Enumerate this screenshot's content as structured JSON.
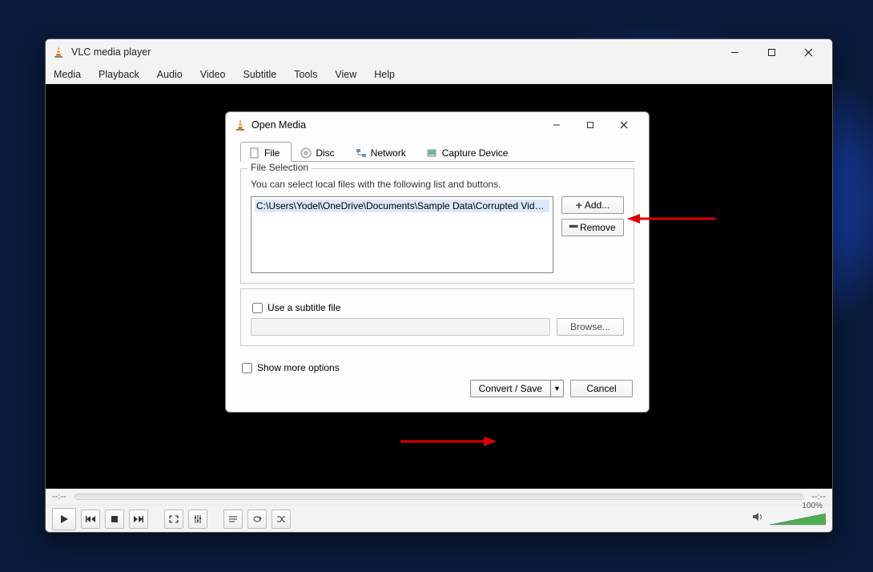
{
  "app": {
    "title": "VLC media player",
    "menu": [
      "Media",
      "Playback",
      "Audio",
      "Video",
      "Subtitle",
      "Tools",
      "View",
      "Help"
    ],
    "time_left": "--:--",
    "time_right": "--:--",
    "volume_label": "100%"
  },
  "dialog": {
    "title": "Open Media",
    "tabs": {
      "file": "File",
      "disc": "Disc",
      "network": "Network",
      "capture": "Capture Device"
    },
    "file_selection_legend": "File Selection",
    "hint": "You can select local files with the following list and buttons.",
    "file_item": "C:\\Users\\Yodel\\OneDrive\\Documents\\Sample Data\\Corrupted Video...",
    "add_btn": "Add...",
    "remove_btn": "Remove",
    "subtitle_checkbox": "Use a subtitle file",
    "browse_btn": "Browse...",
    "more_options": "Show more options",
    "convert_btn": "Convert / Save",
    "cancel_btn": "Cancel"
  }
}
